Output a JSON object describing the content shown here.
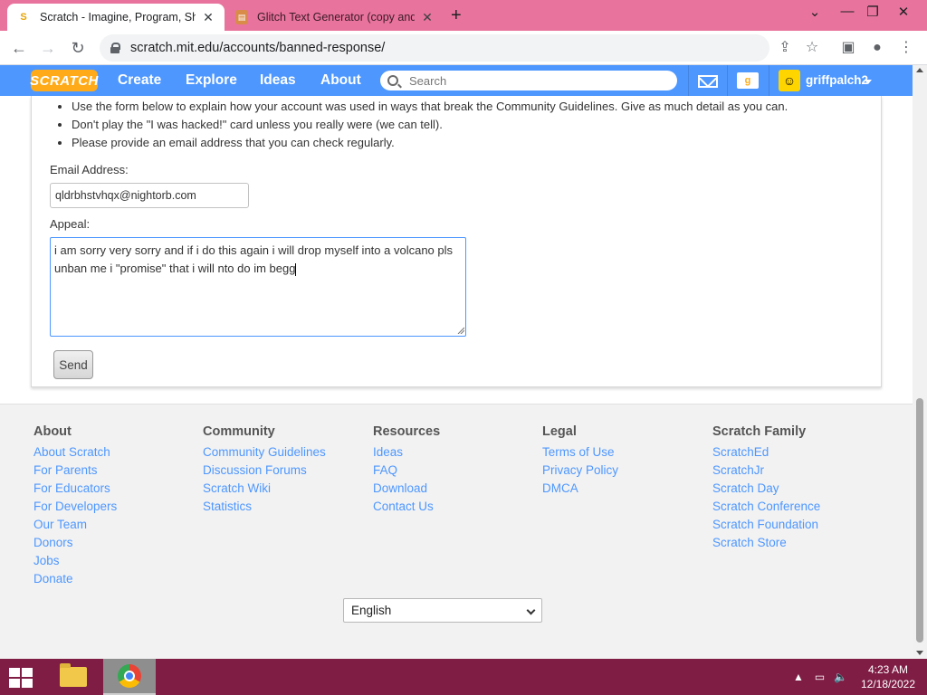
{
  "browser": {
    "tabs": [
      {
        "title": "Scratch - Imagine, Program, Share",
        "favicon": "scratch-favicon"
      },
      {
        "title": "Glitch Text Generator (copy and paste)",
        "favicon": "glitch-favicon"
      }
    ],
    "url": "scratch.mit.edu/accounts/banned-response/"
  },
  "scratch_nav": {
    "logo": "SCRATCH",
    "links": [
      "Create",
      "Explore",
      "Ideas",
      "About"
    ],
    "search_placeholder": "Search",
    "stuff_badge": "g",
    "username": "griffpalch2"
  },
  "form": {
    "bullets": [
      "Use the form below to explain how your account was used in ways that break the Community Guidelines. Give as much detail as you can.",
      "Don't play the \"I was hacked!\" card unless you really were (we can tell).",
      "Please provide an email address that you can check regularly."
    ],
    "email_label": "Email Address:",
    "email_value": "qldrbhstvhqx@nightorb.com",
    "appeal_label": "Appeal:",
    "appeal_value": "i am sorry very sorry and if i do this again i will drop myself into a volcano pls unban me i \"promise\" that i will nto do im begg",
    "send_label": "Send"
  },
  "footer": {
    "columns": [
      {
        "heading": "About",
        "links": [
          "About Scratch",
          "For Parents",
          "For Educators",
          "For Developers",
          "Our Team",
          "Donors",
          "Jobs",
          "Donate"
        ]
      },
      {
        "heading": "Community",
        "links": [
          "Community Guidelines",
          "Discussion Forums",
          "Scratch Wiki",
          "Statistics"
        ]
      },
      {
        "heading": "Resources",
        "links": [
          "Ideas",
          "FAQ",
          "Download",
          "Contact Us"
        ]
      },
      {
        "heading": "Legal",
        "links": [
          "Terms of Use",
          "Privacy Policy",
          "DMCA"
        ]
      },
      {
        "heading": "Scratch Family",
        "links": [
          "ScratchEd",
          "ScratchJr",
          "Scratch Day",
          "Scratch Conference",
          "Scratch Foundation",
          "Scratch Store"
        ]
      }
    ],
    "language": "English"
  },
  "taskbar": {
    "time": "4:23 AM",
    "date": "12/18/2022"
  },
  "colors": {
    "scratch_blue": "#4d97ff",
    "scratch_orange": "#ffab19",
    "tabstrip_pink": "#e8739c",
    "taskbar_maroon": "#7f1d45"
  }
}
